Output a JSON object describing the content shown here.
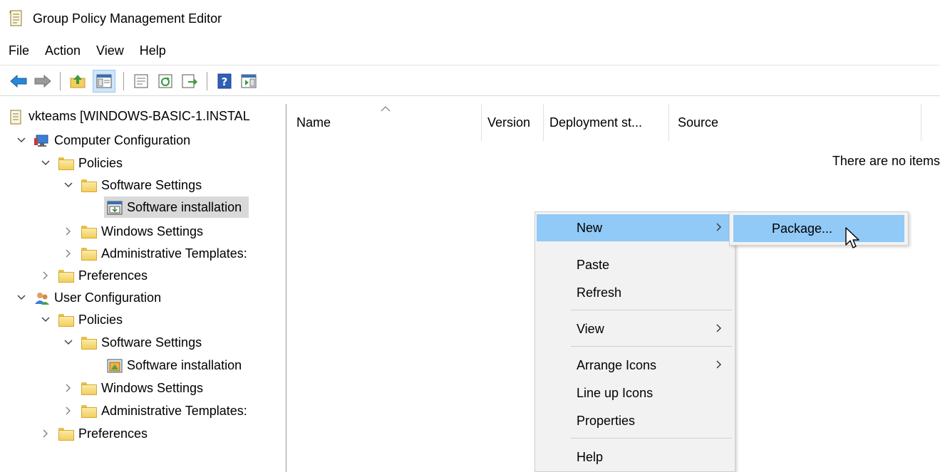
{
  "window": {
    "title": "Group Policy Management Editor"
  },
  "menubar": {
    "items": [
      "File",
      "Action",
      "View",
      "Help"
    ]
  },
  "toolbar": {
    "buttons": [
      "back-icon",
      "forward-icon",
      "up-folder-icon",
      "show-hide-tree-icon",
      "properties-icon",
      "refresh-icon",
      "export-list-icon",
      "help-icon",
      "action-pane-icon"
    ]
  },
  "tree": {
    "root": "vkteams [WINDOWS-BASIC-1.INSTAL",
    "computer_config": "Computer Configuration",
    "cc_policies": "Policies",
    "cc_software_settings": "Software Settings",
    "cc_software_installation": "Software installation",
    "cc_windows_settings": "Windows Settings",
    "cc_admin_templates": "Administrative Templates:",
    "cc_preferences": "Preferences",
    "user_config": "User Configuration",
    "uc_policies": "Policies",
    "uc_software_settings": "Software Settings",
    "uc_software_installation": "Software installation",
    "uc_windows_settings": "Windows Settings",
    "uc_admin_templates": "Administrative Templates:",
    "uc_preferences": "Preferences"
  },
  "list": {
    "columns": [
      "Name",
      "Version",
      "Deployment st...",
      "Source"
    ],
    "empty_message": "There are no items"
  },
  "context_menu": {
    "new": "New",
    "paste": "Paste",
    "refresh": "Refresh",
    "view": "View",
    "arrange_icons": "Arrange Icons",
    "line_up_icons": "Line up Icons",
    "properties": "Properties",
    "help": "Help"
  },
  "submenu": {
    "package": "Package..."
  },
  "colors": {
    "highlight": "#91c9f7",
    "selected_row": "#d9d9d9",
    "menu_bg": "#f2f2f2"
  }
}
